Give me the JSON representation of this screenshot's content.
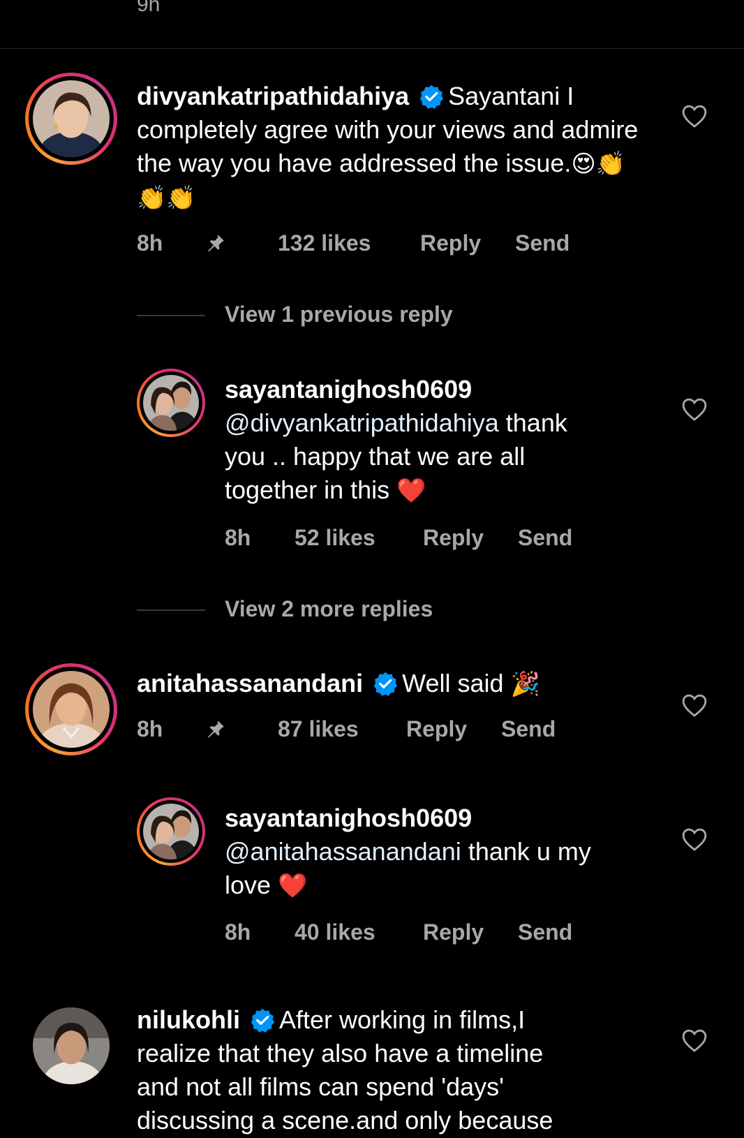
{
  "top_time": "9h",
  "comments": [
    {
      "username": "divyankatripathidahiya",
      "verified": true,
      "text": "Sayantani I completely agree with your views and admire the way you have addressed the issue.",
      "emojis": "😍👏👏👏",
      "time": "8h",
      "pinned": true,
      "likes": "132 likes",
      "reply": "Reply",
      "send": "Send"
    },
    {
      "view_label": "View 1 previous reply"
    },
    {
      "username": "sayantanighosh0609",
      "mention": "@divyankatripathidahiya",
      "text_a": " thank",
      "text_b": "you .. happy that we are all",
      "text_c": "together in this",
      "emoji": "❤️",
      "time": "8h",
      "likes": "52 likes",
      "reply": "Reply",
      "send": "Send"
    },
    {
      "view_label": "View 2 more replies"
    },
    {
      "username": "anitahassanandani",
      "verified": true,
      "text": "Well said",
      "emoji": "🎉",
      "time": "8h",
      "pinned": true,
      "likes": "87 likes",
      "reply": "Reply",
      "send": "Send"
    },
    {
      "username": "sayantanighosh0609",
      "mention": "@anitahassanandani",
      "text_a": " thank u my",
      "text_b": "love",
      "emoji": "❤️",
      "time": "8h",
      "likes": "40 likes",
      "reply": "Reply",
      "send": "Send"
    },
    {
      "username": "nilukohli",
      "verified": true,
      "text_a": "After working in films,I",
      "text_b": "realize that they also have a timeline",
      "text_c": "and not all films can spend 'days'",
      "text_d": "discussing a scene.and only because"
    }
  ],
  "colors": {
    "background": "#000000",
    "muted": "#a8a8a8",
    "verified": "#0095f6",
    "mention": "#e0f1ff"
  }
}
